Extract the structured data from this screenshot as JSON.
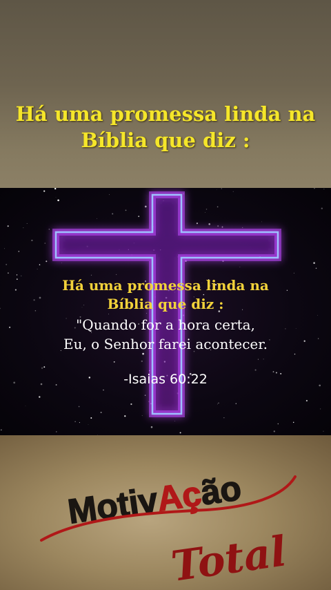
{
  "top": {
    "title_line1": "Há uma promessa linda na",
    "title_line2": "Bíblia que diz :"
  },
  "card": {
    "heading_line1": "Há uma promessa linda na",
    "heading_line2": "Bíblia que diz :",
    "quote_line1": "\"Quando for a hora certa,",
    "quote_line2": "Eu, o Senhor farei acontecer.",
    "reference": "-Isaias 60:22"
  },
  "logo": {
    "word_part1": "Motiv",
    "word_part2": "Aç",
    "word_part3": "ão",
    "script_word": "Total"
  },
  "colors": {
    "title_yellow": "#f5e62a",
    "heading_gold": "#f2d23a",
    "neon_blue": "#8fb4ff",
    "neon_purple": "#c04bff",
    "logo_red": "#b01818"
  }
}
